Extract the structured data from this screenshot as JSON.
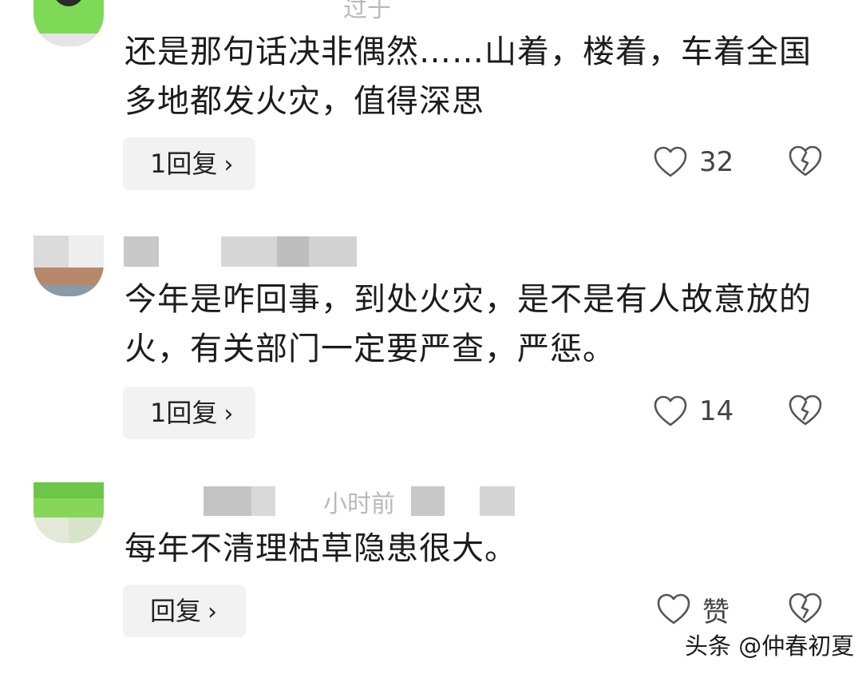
{
  "top_username_fragment": "过于",
  "comments": [
    {
      "text": "还是那句话决非偶然……山着，楼着，车着全国多地都发火灾，值得深思",
      "reply_label": "1回复",
      "like_count": "32"
    },
    {
      "text": "今年是咋回事，到处火灾，是不是有人故意放的火，有关部门一定要严查，严惩。",
      "reply_label": "1回复",
      "like_count": "14"
    },
    {
      "username_fragment": "小时前",
      "text": "每年不清理枯草隐患很大。",
      "reply_label": "回复",
      "like_count": "赞"
    }
  ],
  "watermark": "头条 @仲春初夏",
  "colors": {
    "reply_bg": "#f2f2f2",
    "icon_gray": "#555555",
    "avatar_green": "#7ed957"
  }
}
